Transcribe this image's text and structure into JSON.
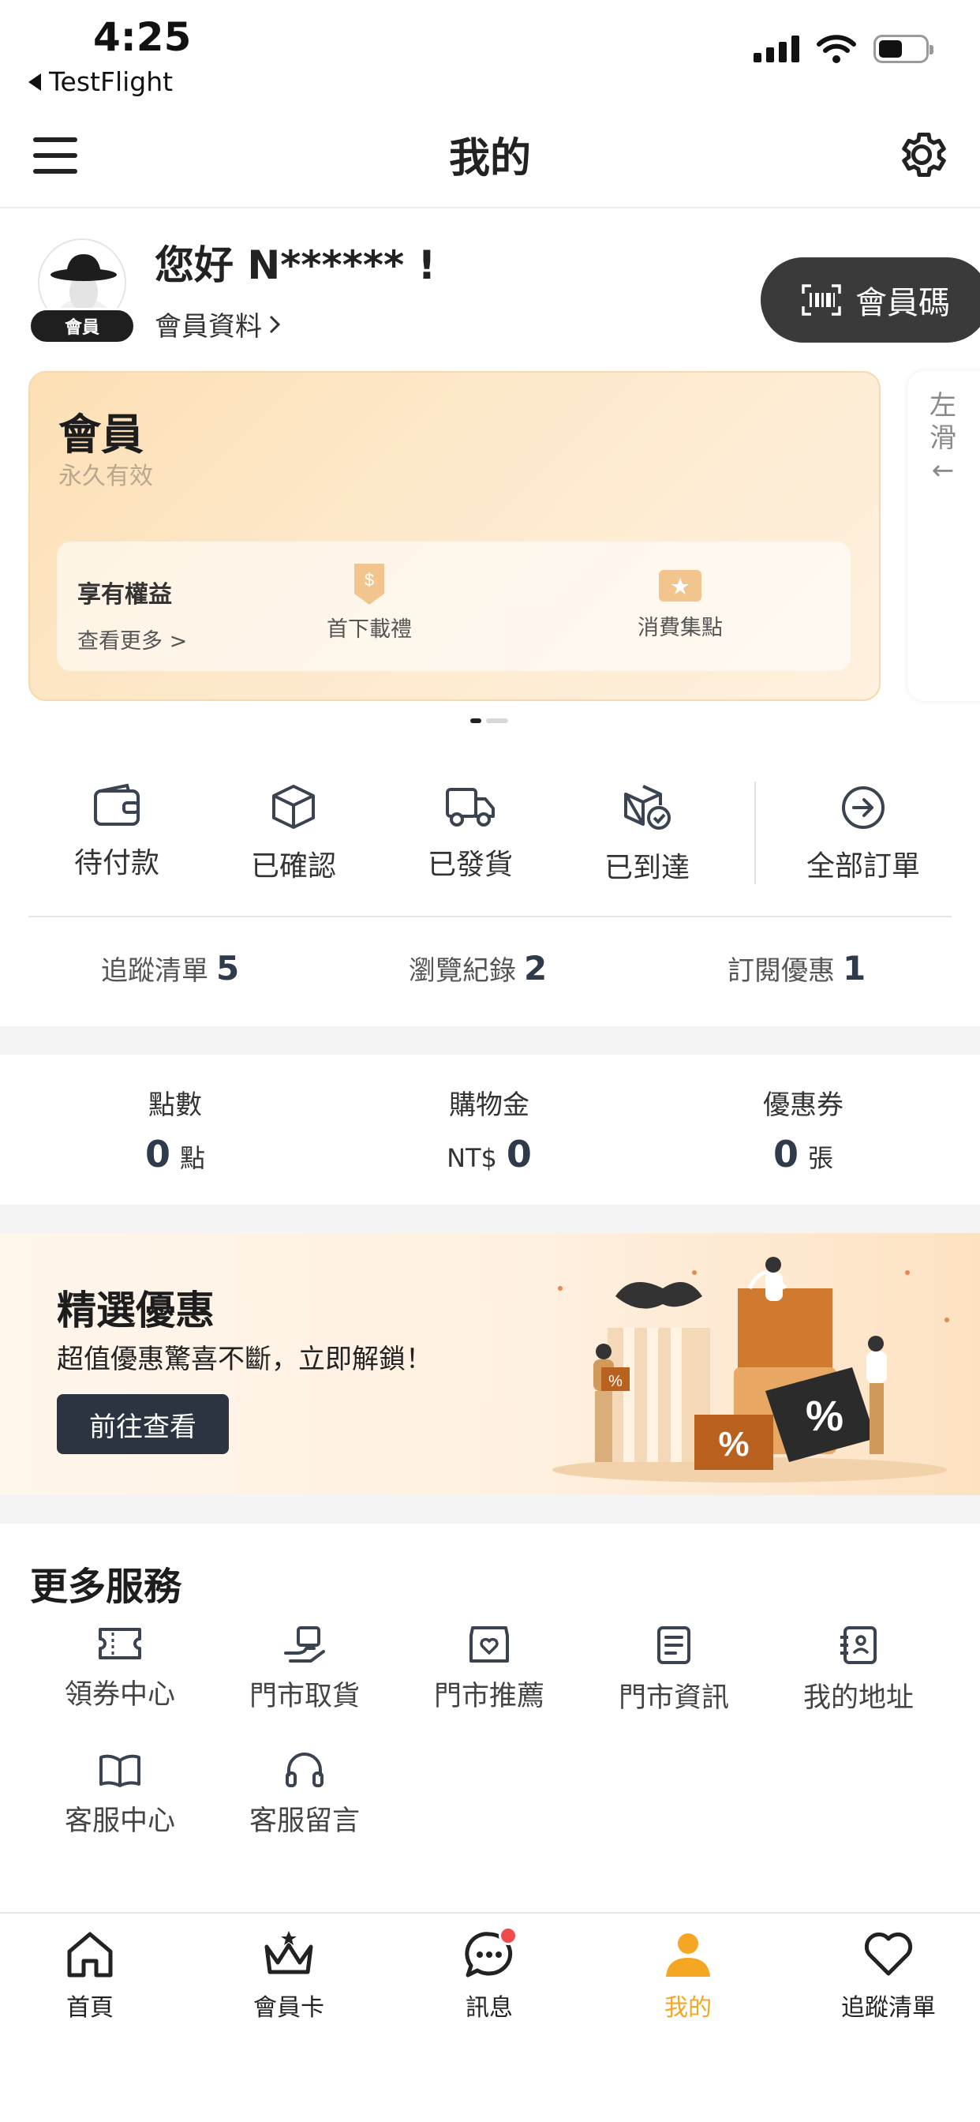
{
  "status_bar": {
    "time": "4:25",
    "back_app": "TestFlight"
  },
  "header": {
    "title": "我的"
  },
  "profile": {
    "greeting": "您好 N****** !",
    "member_badge": "會員",
    "profile_link": "會員資料",
    "member_code_button": "會員碼"
  },
  "member_card": {
    "title": "會員",
    "validity": "永久有效",
    "benefits_title": "享有權益",
    "benefits_more": "查看更多",
    "benefits": [
      {
        "label": "首下載禮",
        "icon": "dollar-tag-icon"
      },
      {
        "label": "消費集點",
        "icon": "point-ticket-icon"
      }
    ],
    "swipe_hint": [
      "左",
      "滑",
      "←"
    ]
  },
  "orders": {
    "items": [
      {
        "label": "待付款",
        "icon": "wallet-icon"
      },
      {
        "label": "已確認",
        "icon": "box-icon"
      },
      {
        "label": "已發貨",
        "icon": "truck-icon"
      },
      {
        "label": "已到達",
        "icon": "box-check-icon"
      },
      {
        "label": "全部訂單",
        "icon": "arrow-circle-icon"
      }
    ],
    "counts": [
      {
        "label": "追蹤清單",
        "value": "5"
      },
      {
        "label": "瀏覽紀錄",
        "value": "2"
      },
      {
        "label": "訂閱優惠",
        "value": "1"
      }
    ]
  },
  "wallet": [
    {
      "label": "點數",
      "prefix": "",
      "value": "0",
      "unit": "點"
    },
    {
      "label": "購物金",
      "prefix": "NT$",
      "value": "0",
      "unit": ""
    },
    {
      "label": "優惠券",
      "prefix": "",
      "value": "0",
      "unit": "張"
    }
  ],
  "promo": {
    "title": "精選優惠",
    "subtitle": "超值優惠驚喜不斷，立即解鎖！",
    "button": "前往查看"
  },
  "services": {
    "title": "更多服務",
    "items": [
      {
        "label": "領券中心",
        "icon": "coupon-icon"
      },
      {
        "label": "門市取貨",
        "icon": "hand-package-icon"
      },
      {
        "label": "門市推薦",
        "icon": "store-heart-icon"
      },
      {
        "label": "門市資訊",
        "icon": "document-icon"
      },
      {
        "label": "我的地址",
        "icon": "address-book-icon"
      },
      {
        "label": "客服中心",
        "icon": "book-icon"
      },
      {
        "label": "客服留言",
        "icon": "headphones-icon"
      }
    ]
  },
  "tabbar": {
    "items": [
      {
        "label": "首頁",
        "icon": "home-icon",
        "active": false
      },
      {
        "label": "會員卡",
        "icon": "crown-icon",
        "active": false
      },
      {
        "label": "訊息",
        "icon": "chat-icon",
        "active": false,
        "badge": true
      },
      {
        "label": "我的",
        "icon": "user-icon",
        "active": true
      },
      {
        "label": "追蹤清單",
        "icon": "heart-icon",
        "active": false
      }
    ]
  },
  "colors": {
    "accent": "#f5a623",
    "dark_button": "#2b3440",
    "badge": "#ef4b4b",
    "card_bg": "#fde0b5"
  }
}
